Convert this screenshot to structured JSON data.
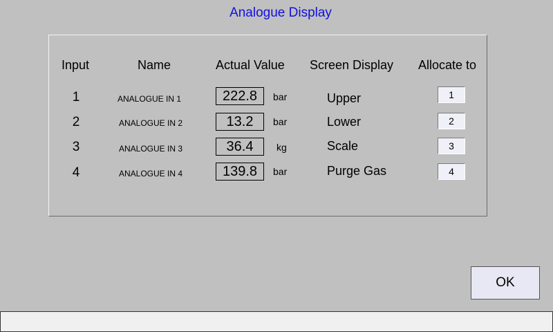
{
  "window": {
    "title": "Analogue Display"
  },
  "table": {
    "headers": {
      "input": "Input",
      "name": "Name",
      "actual_value": "Actual Value",
      "screen_display": "Screen Display",
      "allocate_to": "Allocate to"
    },
    "rows": [
      {
        "input": "1",
        "name": "ANALOGUE  IN 1",
        "value": "222.8",
        "unit": "bar",
        "display": "Upper",
        "allocate": "1"
      },
      {
        "input": "2",
        "name": "ANALOGUE IN 2",
        "value": "13.2",
        "unit": "bar",
        "display": "Lower",
        "allocate": "2"
      },
      {
        "input": "3",
        "name": "ANALOGUE IN 3",
        "value": "36.4",
        "unit": "kg",
        "display": "Scale",
        "allocate": "3"
      },
      {
        "input": "4",
        "name": "ANALOGUE IN 4",
        "value": "139.8",
        "unit": "bar",
        "display": "Purge Gas",
        "allocate": "4"
      }
    ]
  },
  "buttons": {
    "ok_label": "OK"
  },
  "status_bar": {
    "text": ""
  },
  "colors": {
    "background": "#c0c0c0",
    "title": "#1010e0",
    "field_background": "#f0f0f8"
  }
}
